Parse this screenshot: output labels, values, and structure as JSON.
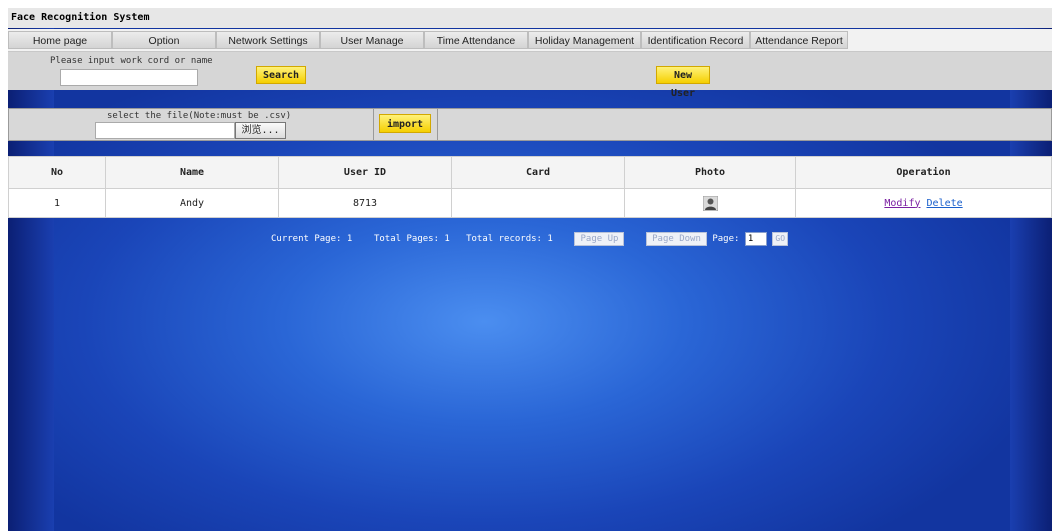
{
  "app": {
    "title": "Face Recognition System"
  },
  "nav": {
    "items": [
      {
        "label": "Home page"
      },
      {
        "label": "Option"
      },
      {
        "label": "Network Settings"
      },
      {
        "label": "User Manage"
      },
      {
        "label": "Time Attendance"
      },
      {
        "label": "Holiday Management"
      },
      {
        "label": "Identification Record"
      },
      {
        "label": "Attendance Report"
      }
    ]
  },
  "search": {
    "label": "Please input work cord or name",
    "value": "",
    "button": "Search",
    "new_user": "New User"
  },
  "import": {
    "label": "select the file(Note:must be .csv)",
    "browse": "浏览...",
    "button": "import"
  },
  "table": {
    "headers": [
      "No",
      "Name",
      "User ID",
      "Card",
      "Photo",
      "Operation"
    ],
    "rows": [
      {
        "no": "1",
        "name": "Andy",
        "user_id": "8713",
        "card": "",
        "photo_icon": "user-avatar-icon",
        "modify": "Modify",
        "delete": "Delete"
      }
    ]
  },
  "pager": {
    "current_label": "Current Page: 1",
    "total_pages_label": "Total Pages: 1",
    "total_records_label": "Total records: 1",
    "page_up": "Page Up",
    "page_down": "Page Down",
    "page_label": "Page:",
    "page_value": "1",
    "go": "GO"
  },
  "colors": {
    "accent_yellow": "#f5cf00",
    "background_blue": "#1a45b8",
    "modify_link": "#7a1fa2",
    "delete_link": "#1a5fcc"
  }
}
